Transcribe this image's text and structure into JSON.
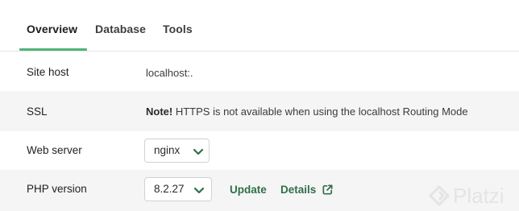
{
  "tabs": [
    {
      "label": "Overview",
      "active": true
    },
    {
      "label": "Database",
      "active": false
    },
    {
      "label": "Tools",
      "active": false
    }
  ],
  "rows": {
    "site_host": {
      "label": "Site host",
      "value": "localhost:."
    },
    "ssl": {
      "label": "SSL",
      "note_prefix": "Note!",
      "note_text": "HTTPS is not available when using the localhost Routing Mode"
    },
    "web_server": {
      "label": "Web server",
      "selected": "nginx"
    },
    "php_version": {
      "label": "PHP version",
      "selected": "8.2.27",
      "update_label": "Update",
      "details_label": "Details"
    }
  },
  "watermark": {
    "text": "Platzi"
  },
  "colors": {
    "accent": "#51b37a",
    "link": "#2f6f4a",
    "shaded_row": "#f5f5f5"
  },
  "icons": [
    "chevron-down-icon",
    "external-link-icon",
    "platzi-logo-icon"
  ]
}
